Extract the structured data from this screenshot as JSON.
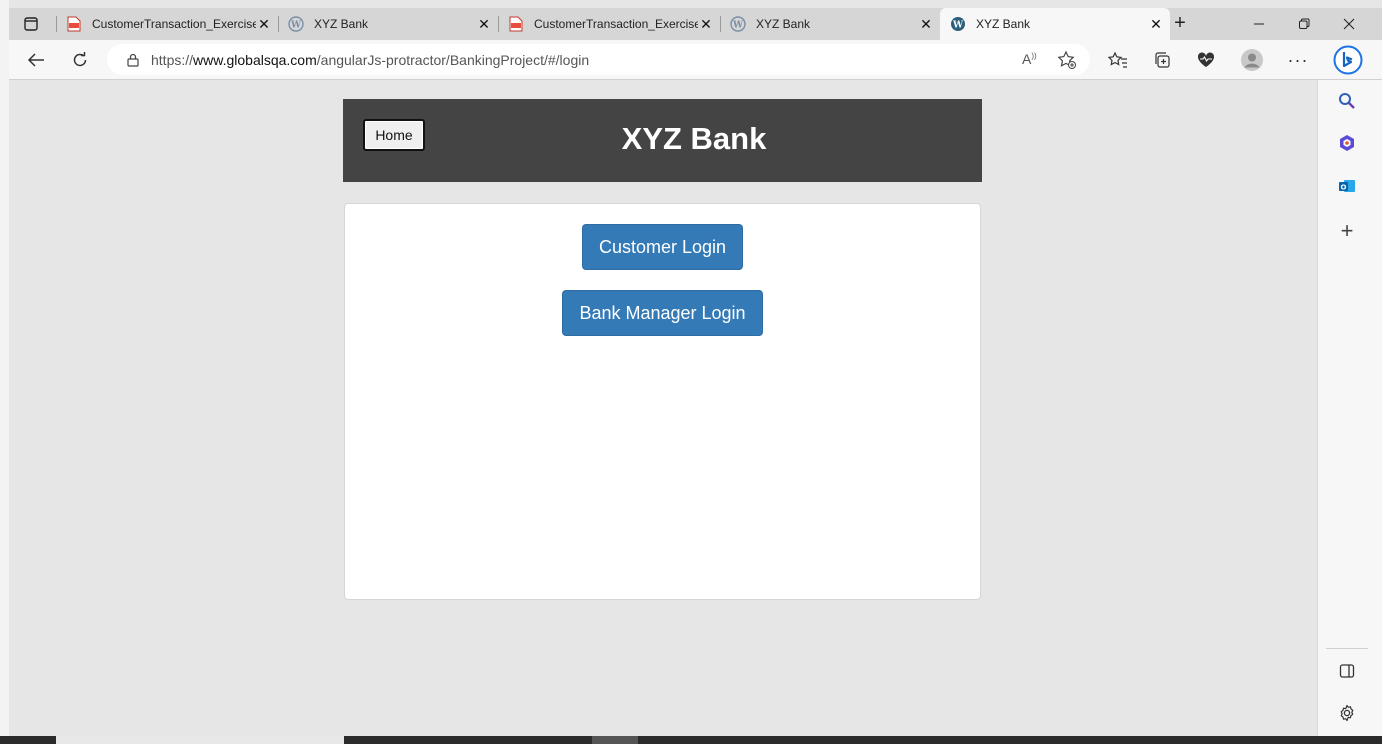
{
  "browser": {
    "tabs": [
      {
        "title": "CustomerTransaction_Exercise",
        "icon": "pdf-icon",
        "active": false
      },
      {
        "title": "XYZ Bank",
        "icon": "wordpress-icon",
        "active": false
      },
      {
        "title": "CustomerTransaction_Exercise",
        "icon": "pdf-icon",
        "active": false
      },
      {
        "title": "XYZ Bank",
        "icon": "wordpress-icon",
        "active": false
      },
      {
        "title": "XYZ Bank",
        "icon": "wordpress-icon",
        "active": true
      }
    ],
    "address": {
      "prefix": "https://",
      "domain": "www.globalsqa.com",
      "path": "/angularJs-protractor/BankingProject/#/login"
    },
    "read_aloud_label": "A"
  },
  "page": {
    "home_label": "Home",
    "title": "XYZ Bank",
    "customer_login_label": "Customer Login",
    "manager_login_label": "Bank Manager Login"
  },
  "colors": {
    "header_bg": "#444444",
    "button_primary": "#337ab7",
    "page_bg": "#e6e6e6"
  }
}
